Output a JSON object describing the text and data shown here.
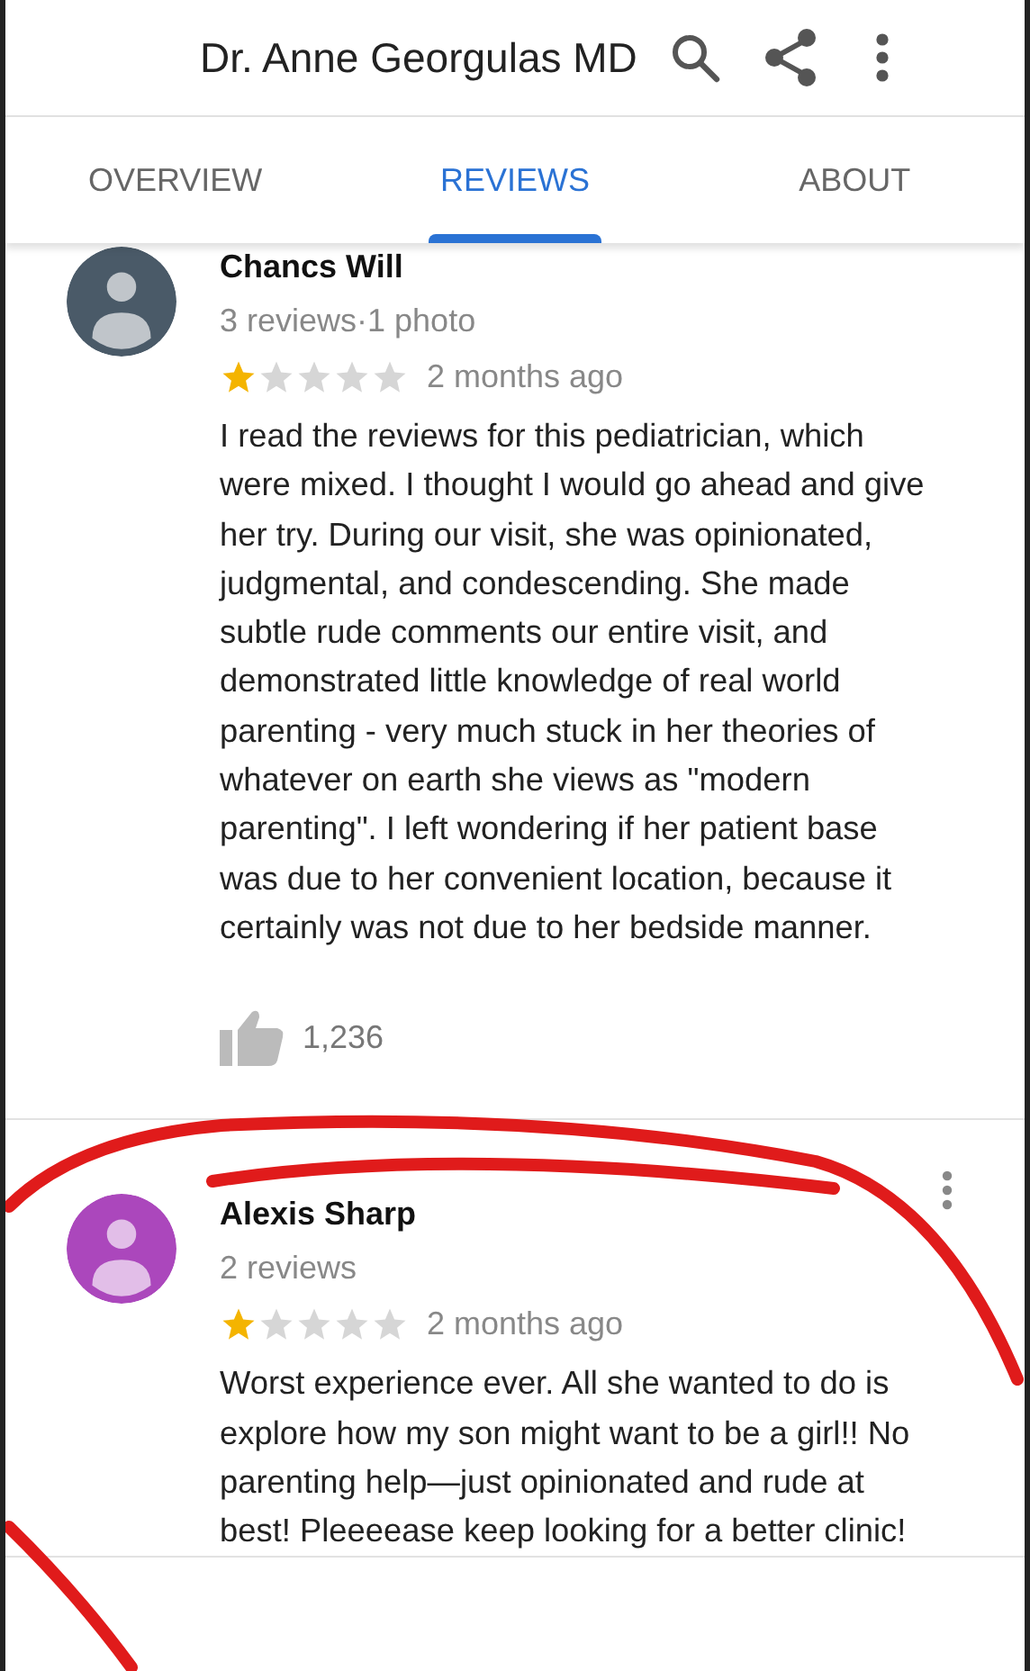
{
  "header": {
    "title": "Dr. Anne Georgulas MD"
  },
  "tabs": [
    {
      "label": "OVERVIEW",
      "selected": false
    },
    {
      "label": "REVIEWS",
      "selected": true
    },
    {
      "label": "ABOUT",
      "selected": false
    }
  ],
  "reviews": [
    {
      "name": "Chancs Will",
      "meta": "3 reviews·1 photo",
      "color": "#4a5a68",
      "stars": 1,
      "time": "2 months ago",
      "body": "I read the reviews for this pediatrician, which were mixed.  I thought I would go ahead and give her try.  During our visit, she was opinionated, judgmental, and condescending. She made subtle rude comments our entire visit, and demonstrated little knowledge of real world parenting - very much stuck in her theories of whatever on earth she views as \"modern parenting\".  I left wondering if her patient base was due to her convenient location, because it certainly was not due to her bedside manner.",
      "likes": "1,236"
    },
    {
      "name": "Alexis Sharp",
      "meta": "2 reviews",
      "color": "#ab47bc",
      "stars": 1,
      "time": "2 months ago",
      "body": "Worst experience ever. All she wanted to do is explore how my son might want to be a girl!! No parenting help—just opinionated and rude at best! Pleeeease keep looking for a better clinic!"
    }
  ]
}
